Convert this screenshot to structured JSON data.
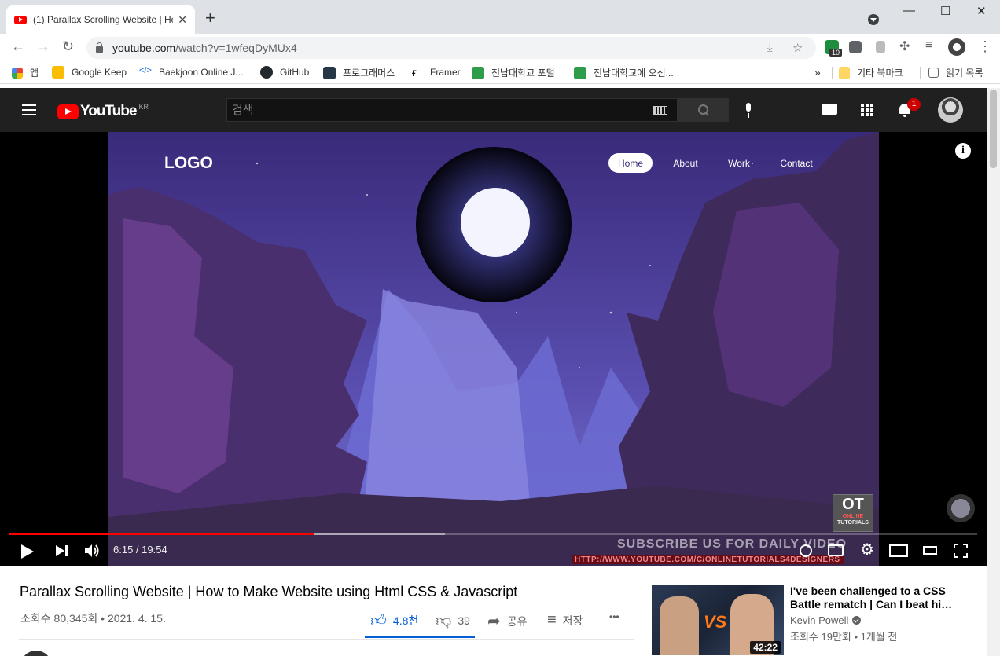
{
  "browser": {
    "tab_title": "(1) Parallax Scrolling Website | How to Make Website using Html CSS & Javascript",
    "tab_close": "✕",
    "new_tab": "+",
    "window_controls": {
      "minimize": "—",
      "maximize": "☐",
      "close": "✕"
    },
    "url_host": "youtube.com",
    "url_path": "/watch?v=1wfeqDyMUx4",
    "extension_badge": "10",
    "bookmarks": [
      {
        "label": "앱",
        "icon": "apps-grid-icon"
      },
      {
        "label": "Google Keep",
        "icon": "keep-icon"
      },
      {
        "label": "Baekjoon Online J...",
        "icon": "code-icon"
      },
      {
        "label": "GitHub",
        "icon": "github-icon"
      },
      {
        "label": "프로그래머스",
        "icon": "programmers-icon"
      },
      {
        "label": "Framer",
        "icon": "framer-icon"
      },
      {
        "label": "전남대학교 포털",
        "icon": "jnu-icon"
      },
      {
        "label": "전남대학교에 오신...",
        "icon": "jnu-icon"
      }
    ],
    "bookmarks_overflow": "»",
    "other_bookmarks": "기타 북마크",
    "reading_list": "읽기 목록"
  },
  "youtube": {
    "logo_text": "YouTube",
    "region": "KR",
    "search_placeholder": "검색",
    "notification_count": "1"
  },
  "player": {
    "scene": {
      "logo": "LOGO",
      "nav": [
        "Home",
        "About",
        "Work",
        "Contact"
      ]
    },
    "info": "i",
    "time": "6:15 / 19:54",
    "played_fraction": 0.314,
    "buffered_fraction": 0.45,
    "watermark_title": "OT",
    "watermark_sub": "ONLINE",
    "watermark_sub2": "TUTORIALS",
    "subscribe_banner": "SUBSCRIBE US FOR DAILY VIDEO",
    "subscribe_url": "HTTP://WWW.YOUTUBE.COM/C/ONLINETUTORIALS4DESIGNERS"
  },
  "video": {
    "title": "Parallax Scrolling Website | How to Make Website using Html CSS & Javascript",
    "views_date": "조회수 80,345회 • 2021. 4. 15.",
    "likes": "4.8천",
    "dislikes": "39",
    "share": "공유",
    "save": "저장",
    "more": "•••"
  },
  "recommended": {
    "title": "I've been challenged to a CSS Battle rematch | Can I beat hi…",
    "channel": "Kevin Powell",
    "meta": "조회수 19만회 • 1개월 전",
    "duration": "42:22",
    "thumb_badge": "VS"
  },
  "colors": {
    "youtube_red": "#ff0000",
    "like_blue": "#065fd4",
    "header_bg": "#202020"
  }
}
